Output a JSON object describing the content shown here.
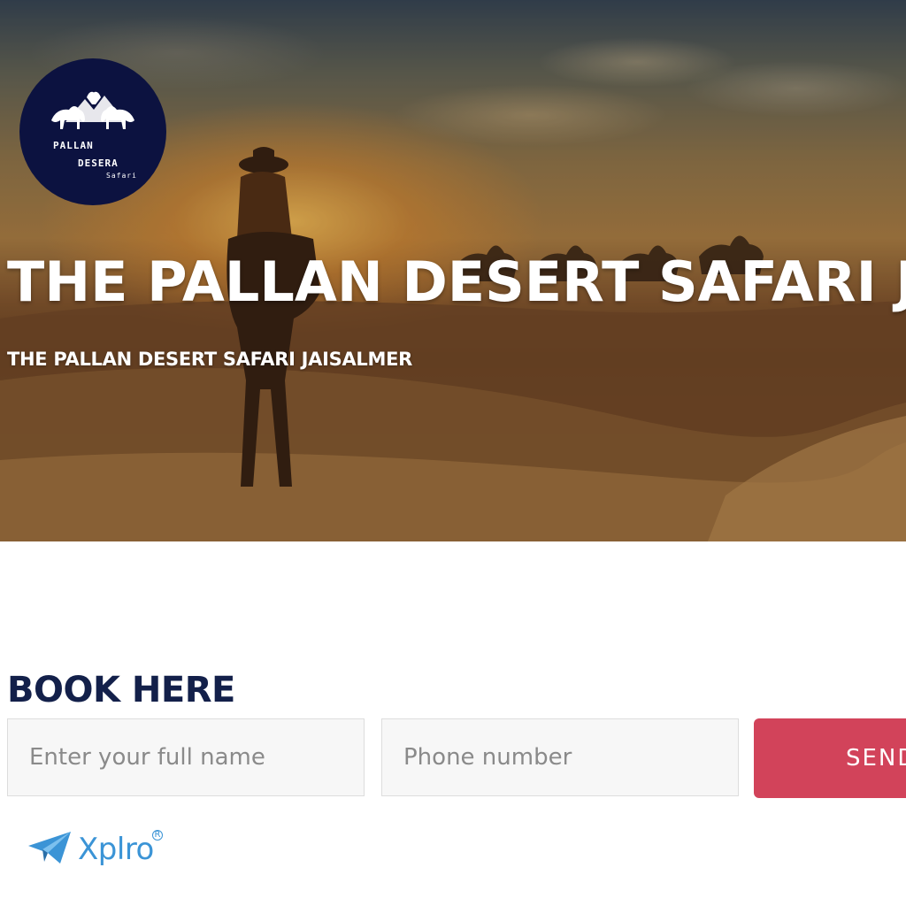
{
  "hero": {
    "title": "THE PALLAN DESERT SAFARI JAISALMER",
    "subtitle": "THE PALLAN DESERT SAFARI JAISALMER"
  },
  "logo": {
    "line1": "PALLAN",
    "line2": "DESERA",
    "line3": "Safari",
    "background": "#0c1240"
  },
  "booking": {
    "heading": "BOOK HERE",
    "name_placeholder": "Enter your full name",
    "name_value": "",
    "phone_placeholder": "Phone number",
    "phone_value": "",
    "send_label": "SEND",
    "accent": "#d2435a",
    "heading_color": "#13204a"
  },
  "footer": {
    "brand": "Xplro",
    "brand_color": "#3b94d6",
    "brand_icon": "paper-plane-icon"
  }
}
